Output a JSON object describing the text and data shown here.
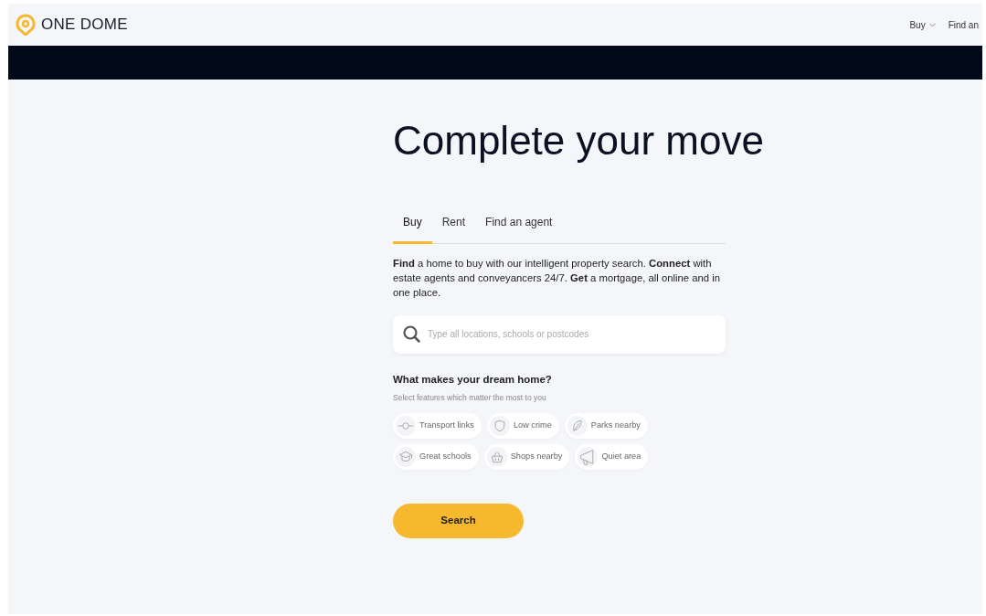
{
  "brand": {
    "name": "ONE DOME"
  },
  "nav": [
    {
      "label": "Buy",
      "dropdown": true
    },
    {
      "label": "Find an",
      "dropdown": false
    }
  ],
  "heading": "Complete your move",
  "tabs": [
    {
      "label": "Buy",
      "selected": true
    },
    {
      "label": "Rent",
      "selected": false
    },
    {
      "label": "Find an agent",
      "selected": false
    }
  ],
  "intro": "**Find** a home to buy with our intelligent property search. **Connect** with estate agents and conveyancers 24/7. **Get** a mortgage, all online and in one place.",
  "search": {
    "placeholder": "Type all locations, schools or postcodes"
  },
  "features": {
    "title": "What makes your dream home?",
    "subtitle": "Select features which matter the most to you",
    "chips": [
      {
        "label": "Transport links",
        "kind": "transport",
        "selected": false
      },
      {
        "label": "Low crime",
        "kind": "shield",
        "selected": false
      },
      {
        "label": "Parks nearby",
        "kind": "leaf",
        "selected": false
      },
      {
        "label": "Great schools",
        "kind": "cap",
        "selected": false
      },
      {
        "label": "Shops nearby",
        "kind": "basket",
        "selected": false
      },
      {
        "label": "Quiet area",
        "kind": "megaphone",
        "selected": false
      }
    ]
  },
  "button": "Search"
}
